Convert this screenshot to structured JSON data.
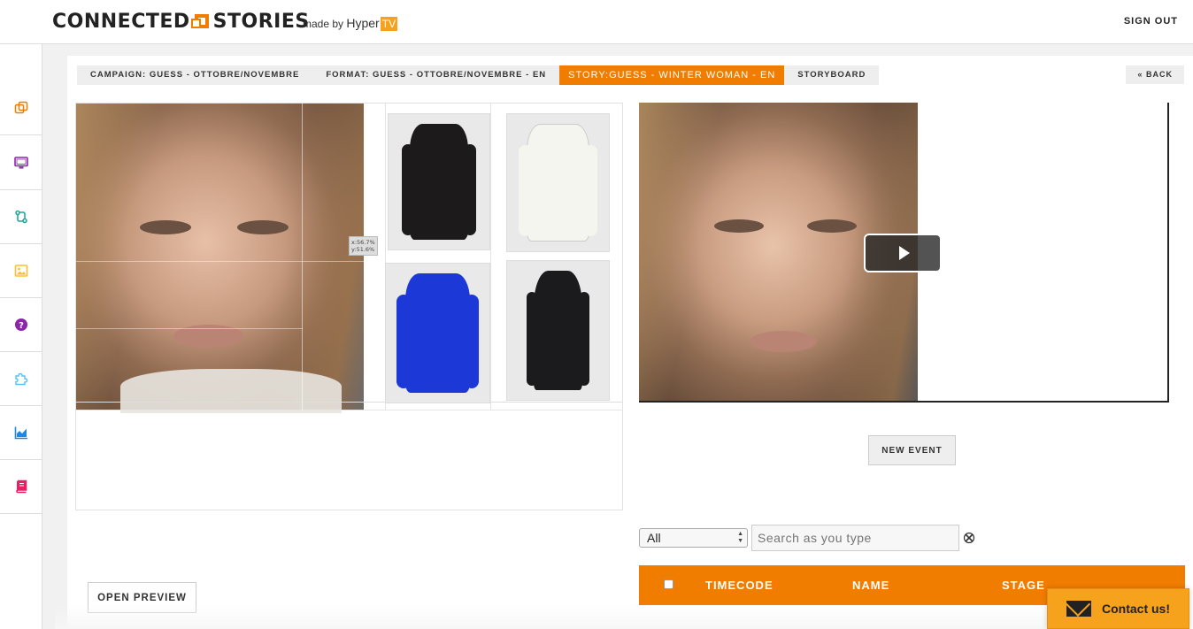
{
  "header": {
    "logo_text_1": "CONNECTED",
    "logo_text_2": "STORIES",
    "made_by": "made by",
    "brand": "Hyper",
    "brand_tv": "TV",
    "sign_out": "SIGN OUT"
  },
  "sidebar": {
    "items": [
      {
        "icon": "copy-icon",
        "color": "#f07d00"
      },
      {
        "icon": "monitor-icon",
        "color": "#8e24aa"
      },
      {
        "icon": "route-icon",
        "color": "#26a69a"
      },
      {
        "icon": "image-icon",
        "color": "#fbc02d"
      },
      {
        "icon": "help-icon",
        "color": "#8e24aa"
      },
      {
        "icon": "puzzle-icon",
        "color": "#4fc3f7"
      },
      {
        "icon": "chart-icon",
        "color": "#1e88e5"
      },
      {
        "icon": "book-icon",
        "color": "#e91e63"
      }
    ]
  },
  "breadcrumbs": {
    "campaign": "CAMPAIGN: GUESS - OTTOBRE/NOVEMBRE",
    "format": "FORMAT: GUESS - OTTOBRE/NOVEMBRE - EN",
    "story": "STORY:GUESS - WINTER WOMAN - EN",
    "storyboard": "STORYBOARD",
    "back": "« BACK"
  },
  "editor": {
    "coord_x": "x:56.7%",
    "coord_y": "y:51.6%",
    "products": [
      {
        "name": "black-fur-hood-jacket",
        "color": "#1c1a1a"
      },
      {
        "name": "white-puffer-jacket",
        "color": "#f4f5ee"
      },
      {
        "name": "blue-puffer-jacket",
        "color": "#1c38d6"
      },
      {
        "name": "black-long-coat",
        "color": "#1b1b1d"
      }
    ]
  },
  "actions": {
    "open_preview": "OPEN PREVIEW",
    "new_event": "NEW EVENT"
  },
  "filter": {
    "selected": "All",
    "search_placeholder": "Search as you type"
  },
  "table": {
    "columns": [
      "TIMECODE",
      "NAME",
      "STAGE"
    ]
  },
  "contact": {
    "label": "Contact us!"
  },
  "colors": {
    "accent": "#f07d00",
    "contact": "#f7a21d"
  }
}
